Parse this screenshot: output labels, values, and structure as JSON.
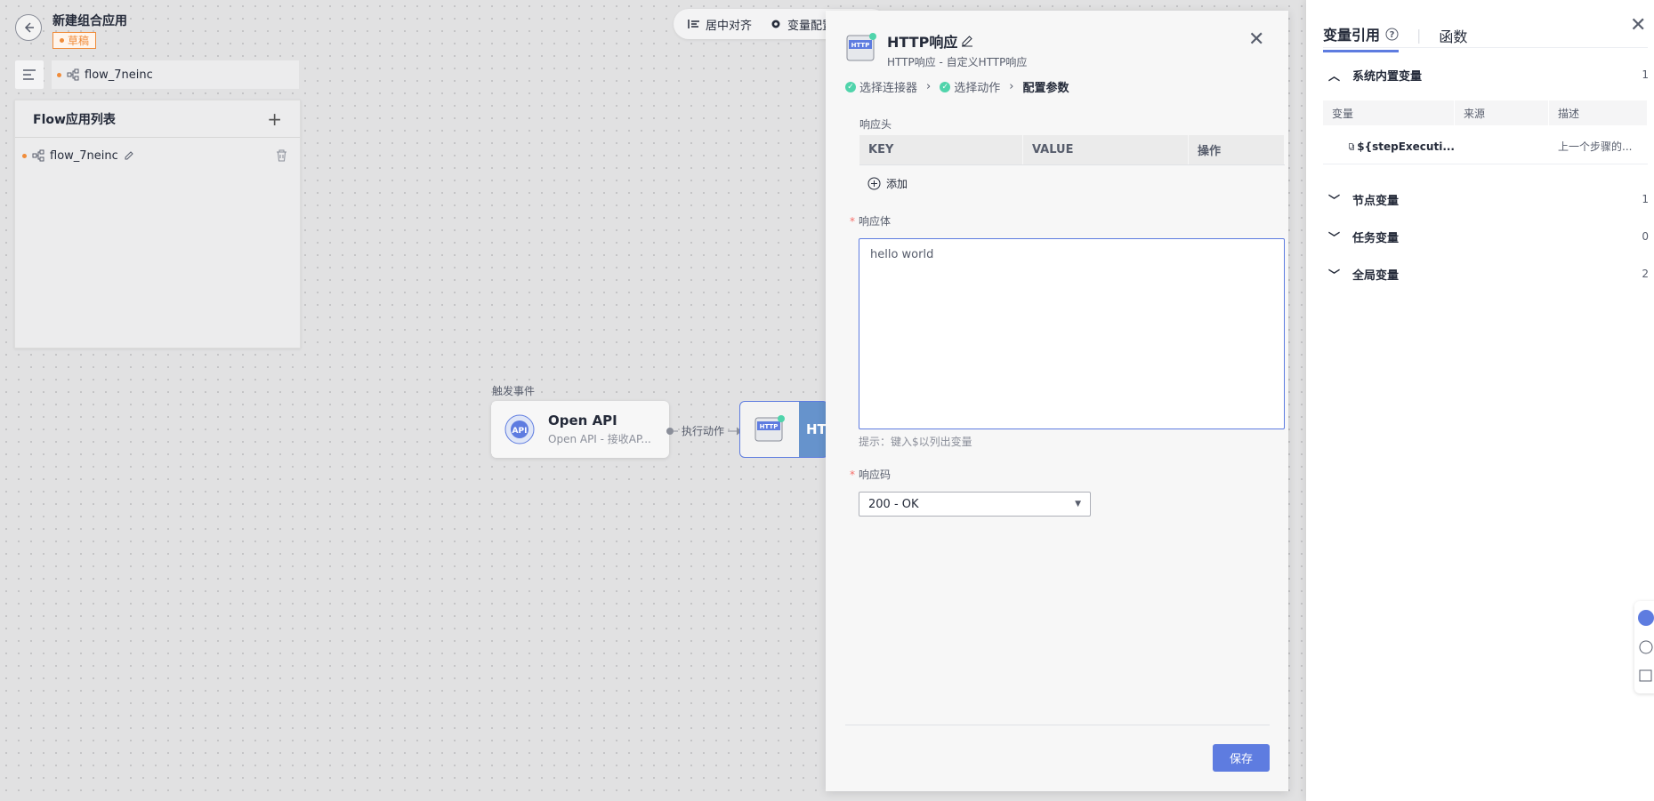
{
  "header": {
    "app_title": "新建组合应用",
    "status": "草稿"
  },
  "flow_tab": {
    "label": "flow_7neinc"
  },
  "flow_list": {
    "title": "Flow应用列表",
    "items": [
      {
        "label": "flow_7neinc"
      }
    ]
  },
  "toolbar": {
    "center_align": "居中对齐",
    "var_config": "变量配置"
  },
  "canvas": {
    "trigger_label": "触发事件",
    "node1": {
      "title": "Open API",
      "subtitle": "Open API - 接收AP...",
      "icon_text": "API"
    },
    "connector_label": "执行动作",
    "node2": {
      "title": "HT",
      "icon_text": "HTTP"
    }
  },
  "panel": {
    "title": "HTTP响应",
    "subtitle": "HTTP响应 - 自定义HTTP响应",
    "icon_text": "HTTP",
    "steps": [
      "选择连接器",
      "选择动作",
      "配置参数"
    ],
    "response_headers_label": "响应头",
    "headers_columns": [
      "KEY",
      "VALUE",
      "操作"
    ],
    "add_label": "添加",
    "response_body_label": "响应体",
    "response_body_value": "hello world",
    "hint": "提示：键入$以列出变量",
    "response_code_label": "响应码",
    "response_code_value": "200 - OK",
    "save_label": "保存"
  },
  "right_panel": {
    "tabs": [
      "变量引用",
      "函数"
    ],
    "groups": [
      {
        "label": "系统内置变量",
        "count": "1"
      },
      {
        "label": "节点变量",
        "count": "1"
      },
      {
        "label": "任务变量",
        "count": "0"
      },
      {
        "label": "全局变量",
        "count": "2"
      }
    ],
    "var_columns": [
      "变量",
      "来源",
      "描述"
    ],
    "var_rows": [
      {
        "name": "${stepExecuti...",
        "source": "",
        "desc": "上一个步骤的..."
      }
    ]
  },
  "colors": {
    "primary": "#5e7ce0",
    "draft": "#f08c3a",
    "success": "#50d4ab",
    "required": "#f66f6a"
  }
}
